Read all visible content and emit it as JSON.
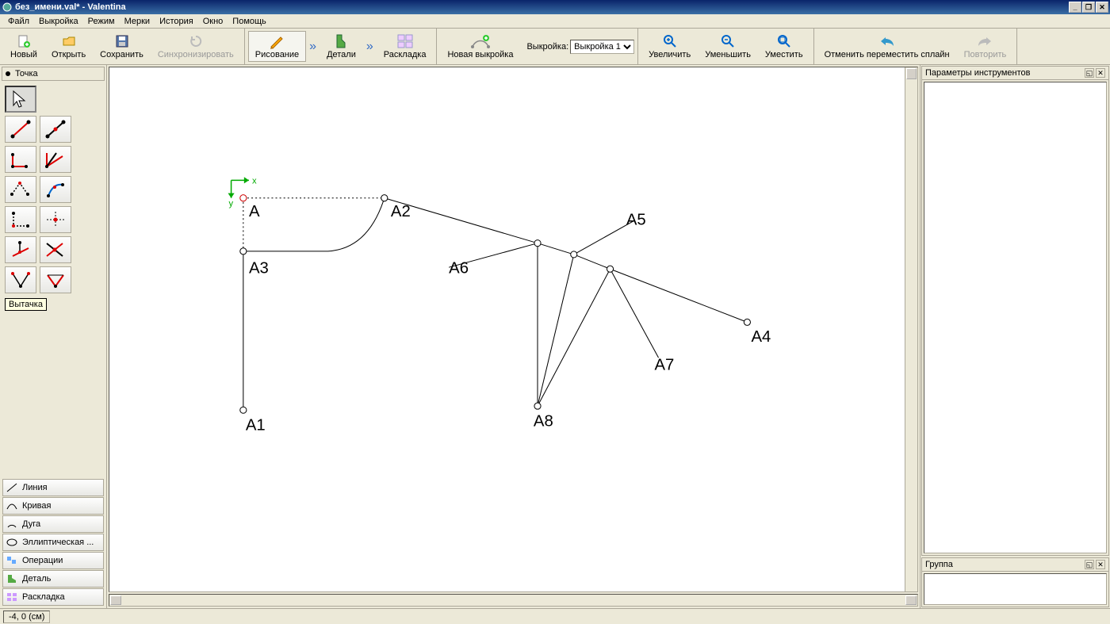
{
  "window": {
    "title": "без_имени.val* - Valentina"
  },
  "menubar": {
    "file": "Файл",
    "pattern": "Выкройка",
    "mode": "Режим",
    "measurements": "Мерки",
    "history": "История",
    "window": "Окно",
    "help": "Помощь"
  },
  "toolbar": {
    "new": "Новый",
    "open": "Открыть",
    "save": "Сохранить",
    "sync": "Синхронизировать",
    "drawing": "Рисование",
    "details": "Детали",
    "layout": "Раскладка",
    "new_pattern": "Новая выкройка",
    "pattern_label": "Выкройка:",
    "pattern_selected": "Выкройка 1",
    "zoom_in": "Увеличить",
    "zoom_out": "Уменьшить",
    "zoom_fit": "Уместить",
    "undo": "Отменить переместить сплайн",
    "redo": "Повторить"
  },
  "palette": {
    "header": "Точка",
    "tooltip": "Вытачка",
    "categories": {
      "line": "Линия",
      "curve": "Кривая",
      "arc": "Дуга",
      "elliptical": "Эллиптическая ...",
      "operations": "Операции",
      "detail": "Деталь",
      "layout": "Раскладка"
    }
  },
  "canvas": {
    "points": {
      "A": "A",
      "A1": "A1",
      "A2": "A2",
      "A3": "A3",
      "A4": "A4",
      "A5": "A5",
      "A6": "A6",
      "A7": "A7",
      "A8": "A8"
    },
    "axis": {
      "x": "x",
      "y": "y"
    }
  },
  "docks": {
    "tool_params": "Параметры инструментов",
    "group": "Группа"
  },
  "statusbar": {
    "coords": "-4, 0 (см)"
  }
}
